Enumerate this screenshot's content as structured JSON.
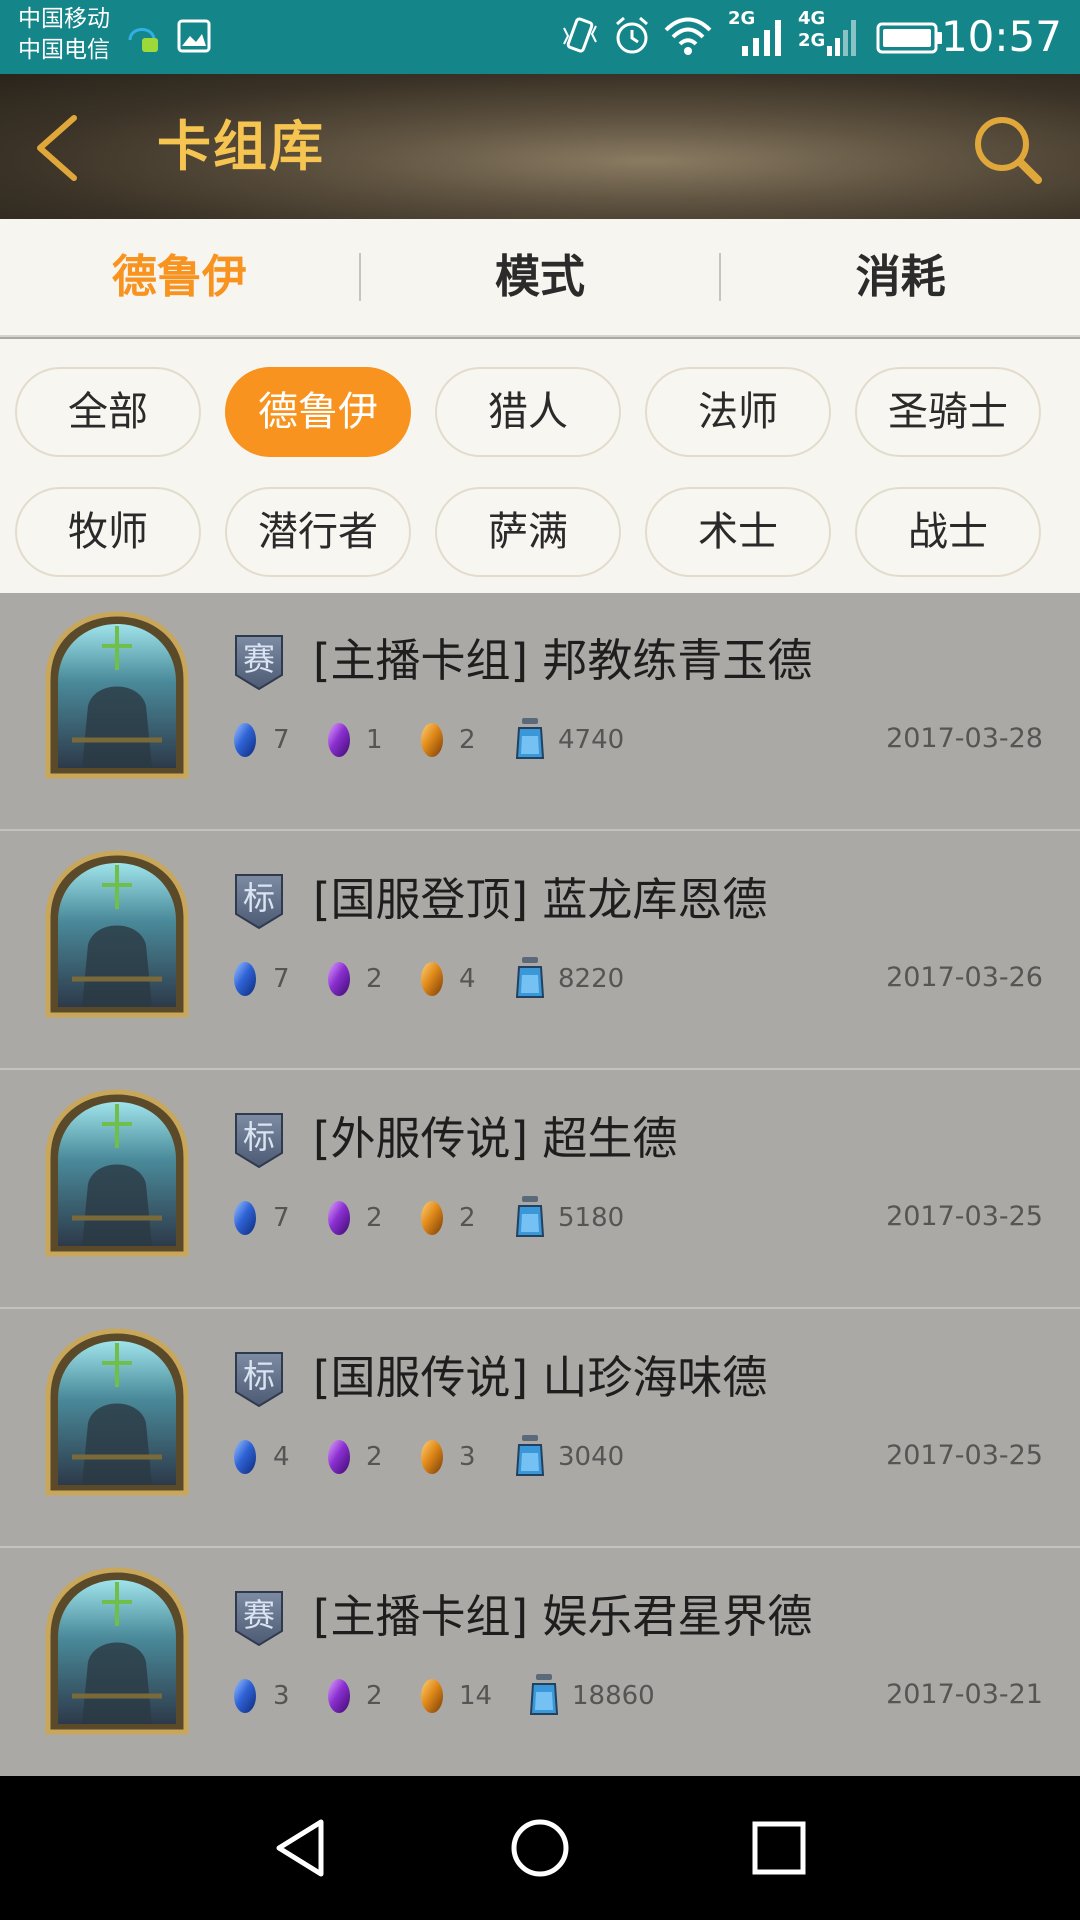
{
  "status_bar": {
    "carrier_1": "中国移动",
    "carrier_2": "中国电信",
    "network_1": "2G",
    "network_2": "4G",
    "network_3": "2G",
    "time": "10:57"
  },
  "header": {
    "title": "卡组库",
    "back_icon": "chevron-left-icon",
    "search_icon": "search-icon",
    "accent_color": "#f6c451"
  },
  "tabs": [
    {
      "label": "德鲁伊",
      "active": true
    },
    {
      "label": "模式",
      "active": false
    },
    {
      "label": "消耗",
      "active": false
    }
  ],
  "filters": {
    "chips": [
      "全部",
      "德鲁伊",
      "猎人",
      "法师",
      "圣骑士",
      "牧师",
      "潜行者",
      "萨满",
      "术士",
      "战士"
    ],
    "selected": "德鲁伊",
    "active_color": "#f7931e"
  },
  "decks": [
    {
      "mode": "赛",
      "title": "[主播卡组] 邦教练青玉德",
      "rare": "7",
      "epic": "1",
      "legendary": "2",
      "dust": "4740",
      "date": "2017-03-28"
    },
    {
      "mode": "标",
      "title": "[国服登顶] 蓝龙库恩德",
      "rare": "7",
      "epic": "2",
      "legendary": "4",
      "dust": "8220",
      "date": "2017-03-26"
    },
    {
      "mode": "标",
      "title": "[外服传说] 超生德",
      "rare": "7",
      "epic": "2",
      "legendary": "2",
      "dust": "5180",
      "date": "2017-03-25"
    },
    {
      "mode": "标",
      "title": "[国服传说] 山珍海味德",
      "rare": "4",
      "epic": "2",
      "legendary": "3",
      "dust": "3040",
      "date": "2017-03-25"
    },
    {
      "mode": "赛",
      "title": "[主播卡组] 娱乐君星界德",
      "rare": "3",
      "epic": "2",
      "legendary": "14",
      "dust": "18860",
      "date": "2017-03-21"
    }
  ],
  "nav_bar": {
    "icons": [
      "back-triangle-icon",
      "home-circle-icon",
      "recents-square-icon"
    ]
  }
}
